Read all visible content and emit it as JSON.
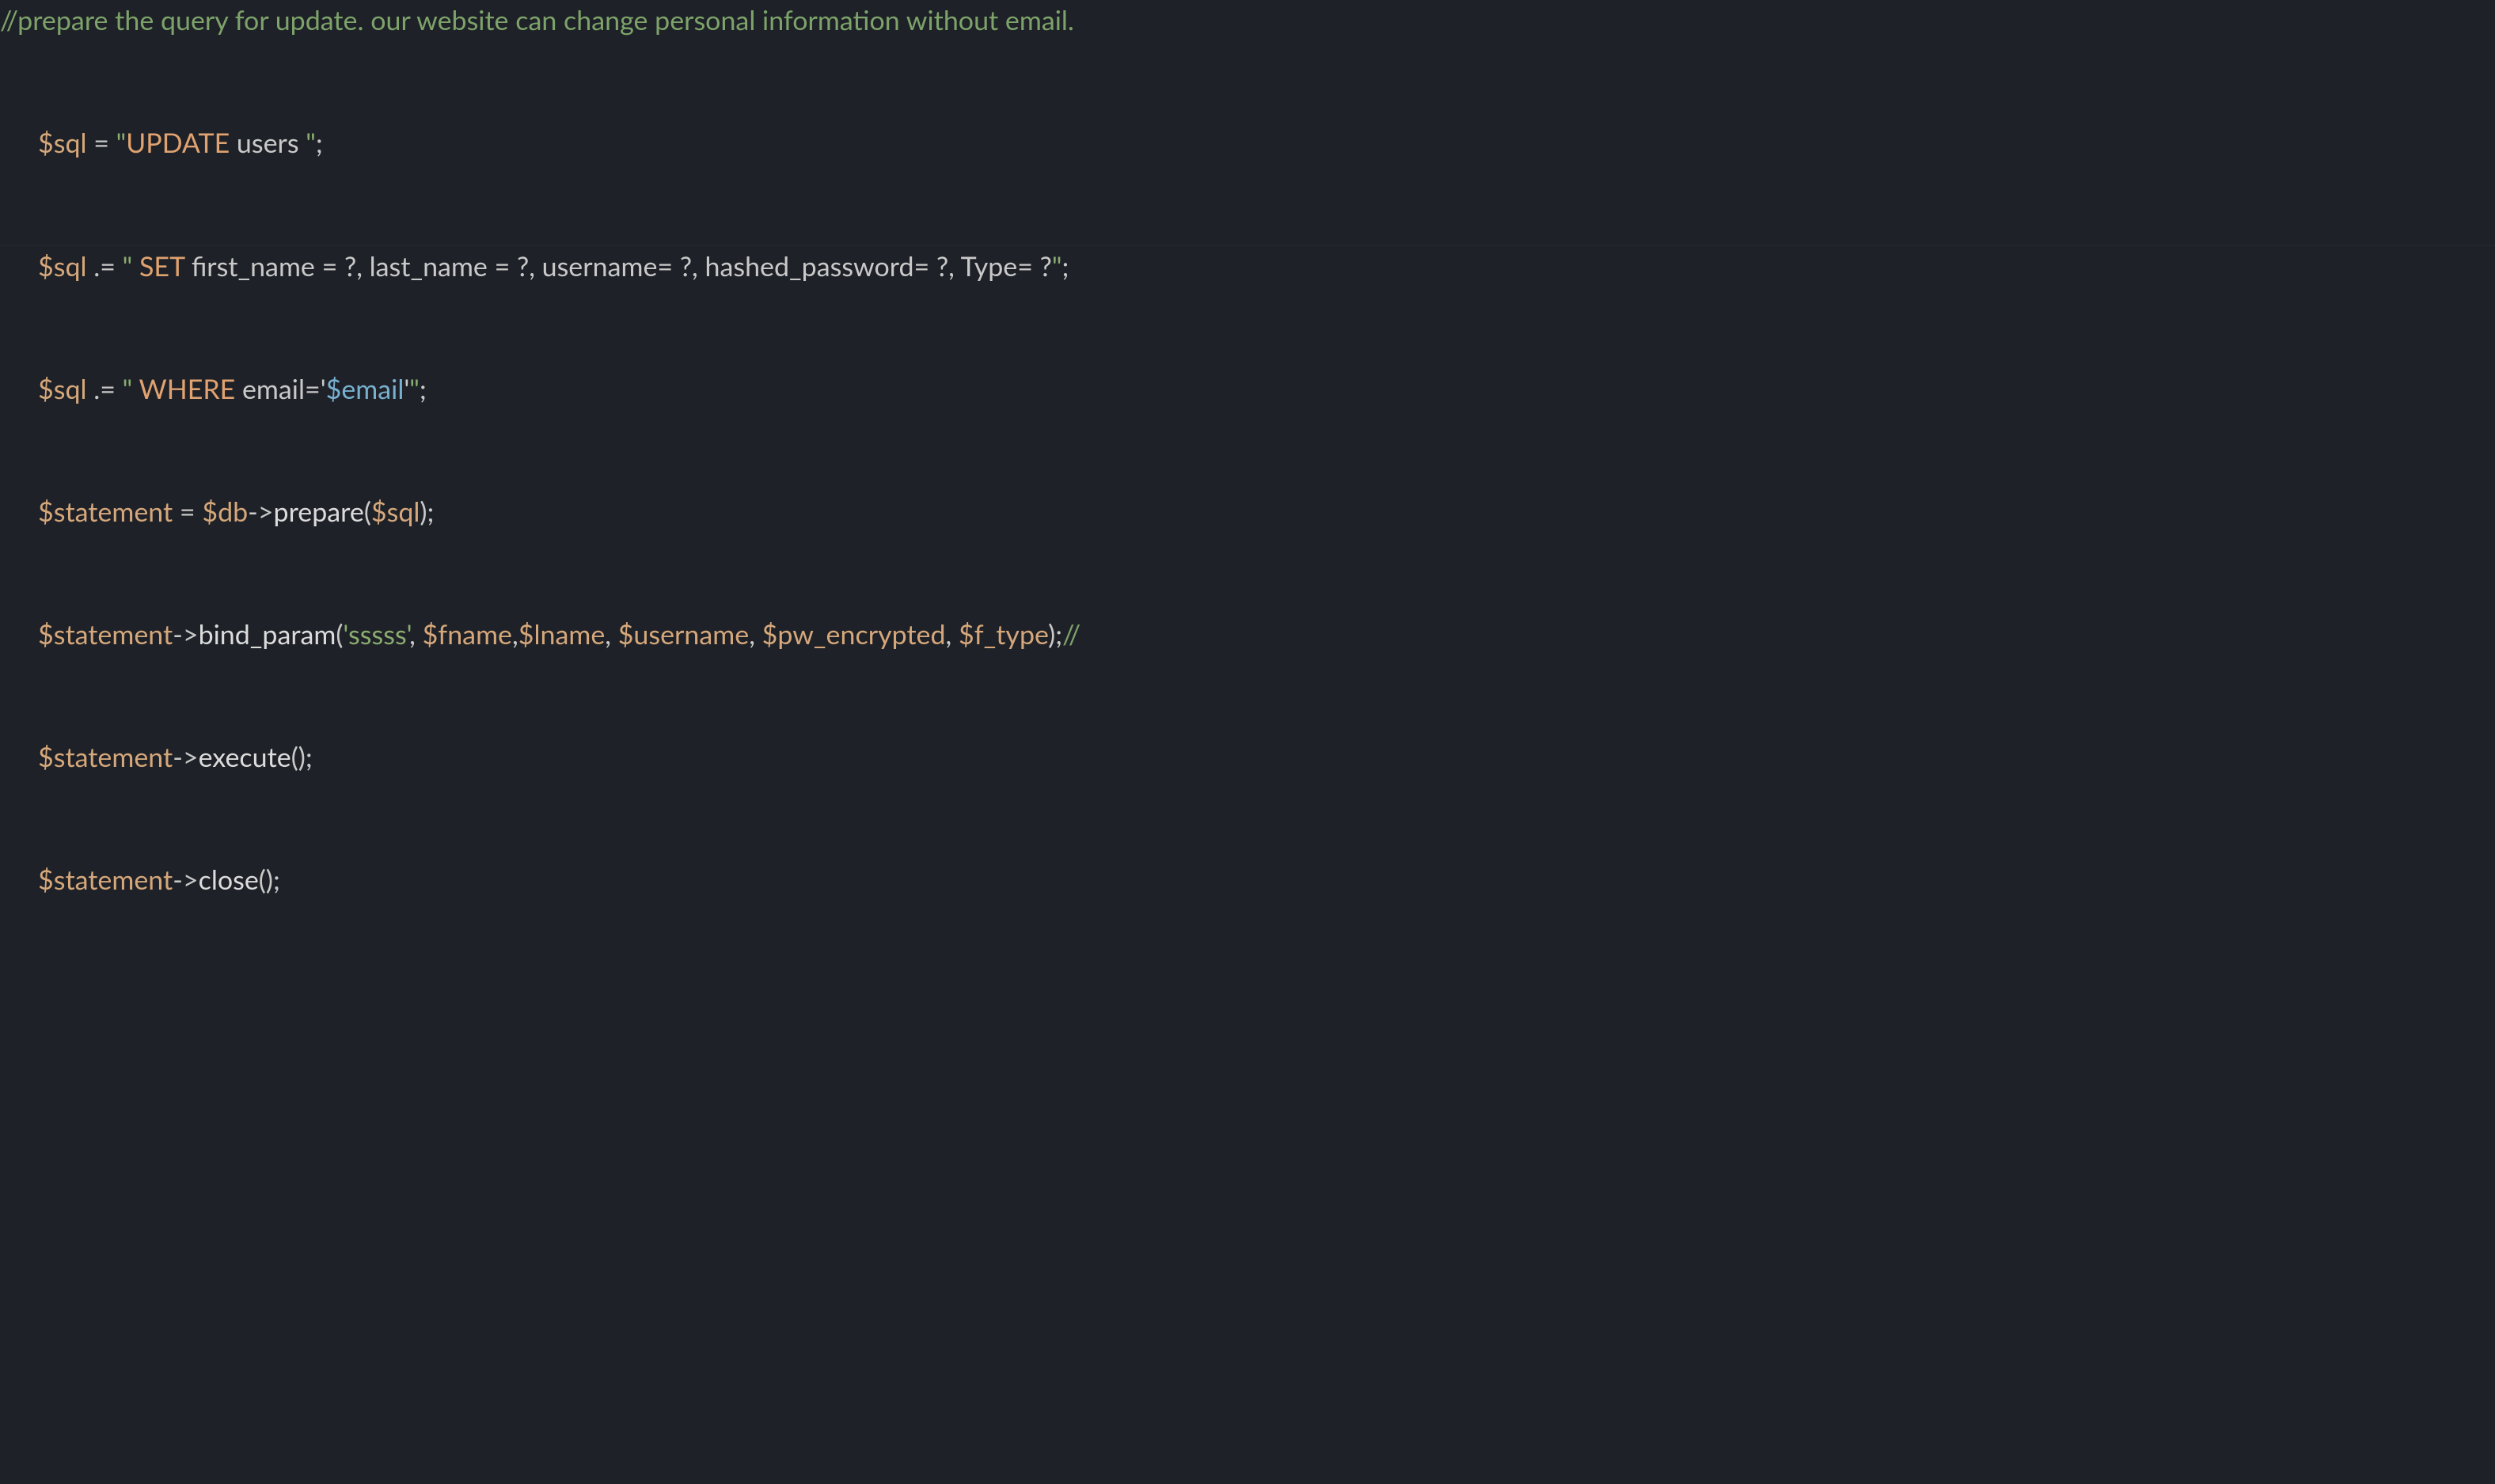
{
  "code": {
    "comment_top": "//prepare the query for update. our website can change personal information without email.",
    "l1": {
      "var": "$sql",
      "eq": " = ",
      "q1": "\"",
      "kw": "UPDATE",
      "rest": " users ",
      "q2": "\"",
      "semi": ";"
    },
    "l2": {
      "var": "$sql",
      "concat": " .= ",
      "q1": "\"",
      "kw": " SET",
      "rest": " first_name = ?, last_name = ?, username= ?, hashed_password= ?, Type= ?",
      "q2": "\"",
      "semi": ";"
    },
    "l3": {
      "var": "$sql",
      "concat": " .= ",
      "q1": "\"",
      "kw": " WHERE",
      "rest_a": " email='",
      "emailvar": "$email",
      "rest_b": "'",
      "q2": "\"",
      "semi": ";"
    },
    "l4": {
      "stmt": "$statement",
      "eq": " = ",
      "db": "$db",
      "arrow": "->",
      "func": "prepare",
      "open": "(",
      "arg": "$sql",
      "close": ")",
      "semi": ";"
    },
    "l5": {
      "stmt": "$statement",
      "arrow": "->",
      "func": "bind_param",
      "open": "(",
      "str": "'sssss'",
      "comma1": ", ",
      "a1": "$fname",
      "c2": ",",
      "a2": "$lname",
      "c3": ", ",
      "a3": "$username",
      "c4": ", ",
      "a4": "$pw_encrypted",
      "c5": ", ",
      "a5": "$f_type",
      "close": ")",
      "semi": ";",
      "tail": "//"
    },
    "l6": {
      "stmt": "$statement",
      "arrow": "->",
      "func": "execute",
      "open": "(",
      "close": ")",
      "semi": ";"
    },
    "l7": {
      "stmt": "$statement",
      "arrow": "->",
      "func": "close",
      "open": "(",
      "close": ")",
      "semi": ";"
    }
  }
}
